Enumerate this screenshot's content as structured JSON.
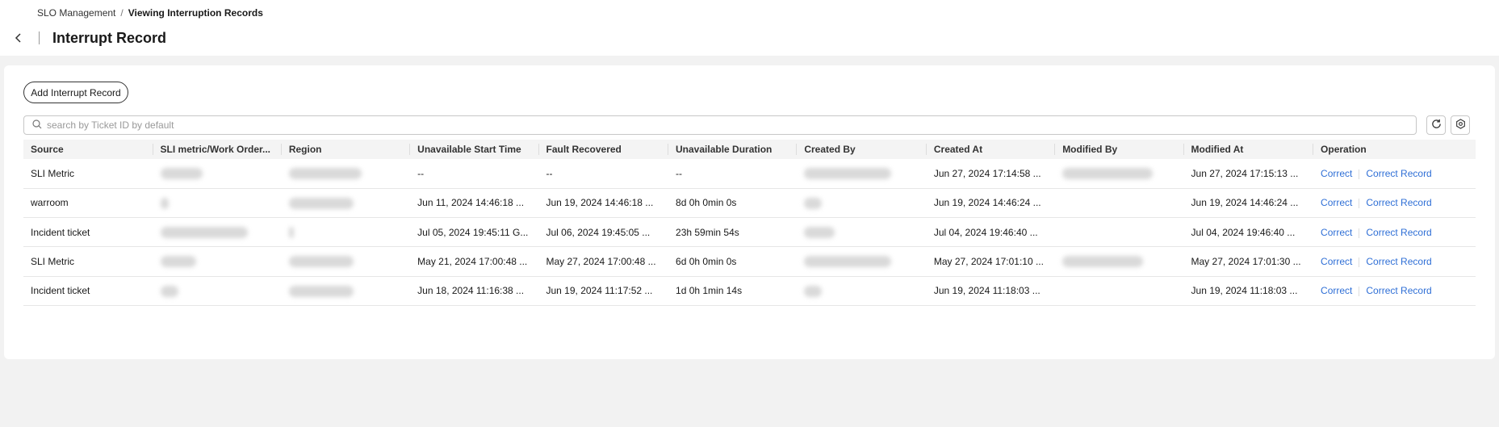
{
  "breadcrumb": {
    "parent": "SLO Management",
    "separator": "/",
    "current": "Viewing Interruption Records"
  },
  "header": {
    "title": "Interrupt Record"
  },
  "toolbar": {
    "add_label": "Add Interrupt Record",
    "search_placeholder": "search by Ticket ID by default"
  },
  "table": {
    "columns": [
      "Source",
      "SLI metric/Work Order...",
      "Region",
      "Unavailable Start Time",
      "Fault Recovered",
      "Unavailable Duration",
      "Created By",
      "Created At",
      "Modified By",
      "Modified At",
      "Operation"
    ],
    "rows": [
      {
        "source": "SLI Metric",
        "start": "--",
        "recovered": "--",
        "duration": "--",
        "created_at": "Jun 27, 2024 17:14:58 ...",
        "modified_at": "Jun 27, 2024 17:15:13 ...",
        "op1": "Correct",
        "op2": "Correct Record"
      },
      {
        "source": "warroom",
        "start": "Jun 11, 2024 14:46:18 ...",
        "recovered": "Jun 19, 2024 14:46:18 ...",
        "duration": "8d 0h 0min 0s",
        "created_at": "Jun 19, 2024 14:46:24 ...",
        "modified_at": "Jun 19, 2024 14:46:24 ...",
        "op1": "Correct",
        "op2": "Correct Record"
      },
      {
        "source": "Incident ticket",
        "start": "Jul 05, 2024 19:45:11 G...",
        "recovered": "Jul 06, 2024 19:45:05 ...",
        "duration": "23h 59min 54s",
        "created_at": "Jul 04, 2024 19:46:40 ...",
        "modified_at": "Jul 04, 2024 19:46:40 ...",
        "op1": "Correct",
        "op2": "Correct Record"
      },
      {
        "source": "SLI Metric",
        "start": "May 21, 2024 17:00:48 ...",
        "recovered": "May 27, 2024 17:00:48 ...",
        "duration": "6d 0h 0min 0s",
        "created_at": "May 27, 2024 17:01:10 ...",
        "modified_at": "May 27, 2024 17:01:30 ...",
        "op1": "Correct",
        "op2": "Correct Record"
      },
      {
        "source": "Incident ticket",
        "start": "Jun 18, 2024 11:16:38 ...",
        "recovered": "Jun 19, 2024 11:17:52 ...",
        "duration": "1d 0h 1min 14s",
        "created_at": "Jun 19, 2024 11:18:03 ...",
        "modified_at": "Jun 19, 2024 11:18:03 ...",
        "op1": "Correct",
        "op2": "Correct Record"
      }
    ]
  },
  "colors": {
    "link": "#2f6fd6",
    "header_bg": "#f4f4f4",
    "page_bg": "#f2f2f2"
  },
  "icons": {
    "back": "chevron-left-icon",
    "search": "search-icon",
    "refresh": "refresh-icon",
    "settings": "settings-icon"
  }
}
